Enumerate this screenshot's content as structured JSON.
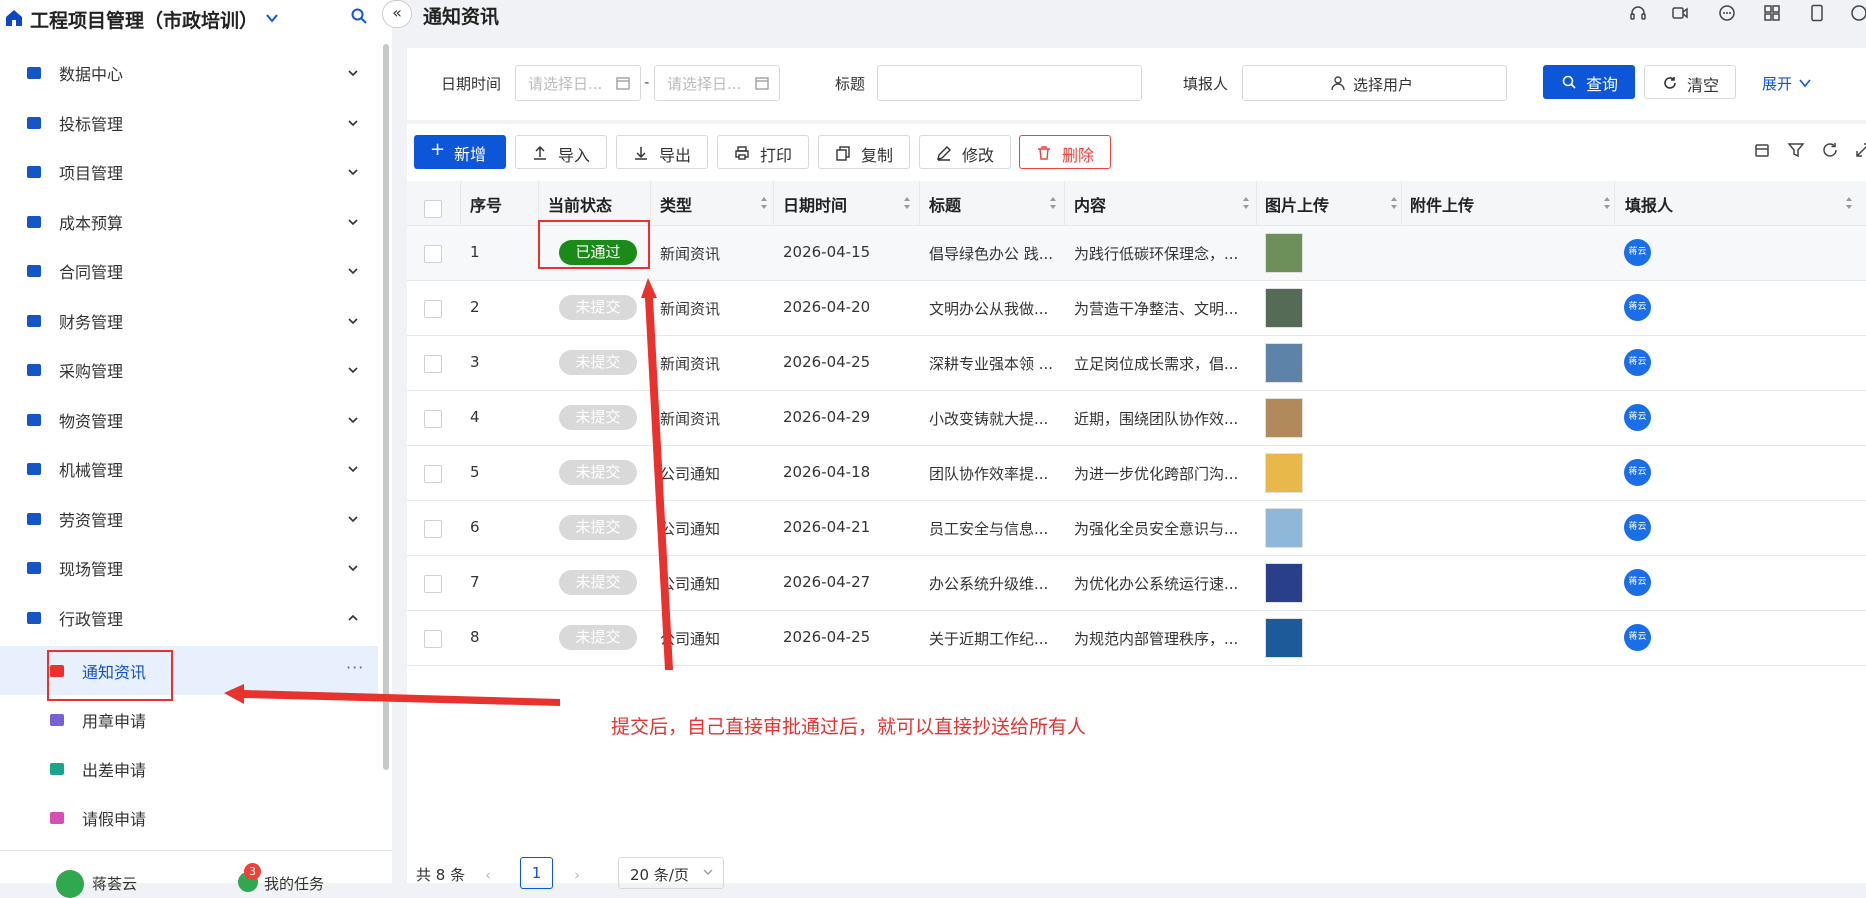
{
  "app": {
    "title": "工程项目管理（市政培训）"
  },
  "sidebar": {
    "menu": [
      {
        "label": "数据中心",
        "icon": "compass-icon"
      },
      {
        "label": "投标管理",
        "icon": "network-icon"
      },
      {
        "label": "项目管理",
        "icon": "project-icon"
      },
      {
        "label": "成本预算",
        "icon": "layers-icon"
      },
      {
        "label": "合同管理",
        "icon": "briefcase-icon"
      },
      {
        "label": "财务管理",
        "icon": "coins-icon"
      },
      {
        "label": "采购管理",
        "icon": "truck-icon"
      },
      {
        "label": "物资管理",
        "icon": "materials-icon"
      },
      {
        "label": "机械管理",
        "icon": "gears-icon"
      },
      {
        "label": "劳资管理",
        "icon": "worker-icon"
      },
      {
        "label": "现场管理",
        "icon": "helmet-icon"
      },
      {
        "label": "行政管理",
        "icon": "archive-icon"
      }
    ],
    "sub_menu": [
      {
        "label": "通知资讯",
        "icon": "megaphone-icon",
        "active": true
      },
      {
        "label": "用章申请",
        "icon": "stamp-icon"
      },
      {
        "label": "出差申请",
        "icon": "travel-icon"
      },
      {
        "label": "请假申请",
        "icon": "edit-icon"
      }
    ],
    "more": "···",
    "footer": {
      "user_name": "蒋荟云",
      "task_label": "我的任务",
      "task_badge": "3"
    }
  },
  "header": {
    "page_title": "通知资讯"
  },
  "filter": {
    "date_label": "日期时间",
    "date_start_placeholder": "请选择日...",
    "date_end_placeholder": "请选择日...",
    "date_dash": "-",
    "title_label": "标题",
    "reporter_label": "填报人",
    "user_select": "选择用户",
    "query_button": "查询",
    "clear_button": "清空",
    "expand_link": "展开"
  },
  "toolbar": {
    "add": "新增",
    "import": "导入",
    "export": "导出",
    "print": "打印",
    "copy": "复制",
    "edit": "修改",
    "delete": "删除"
  },
  "table": {
    "columns": [
      "序号",
      "当前状态",
      "类型",
      "日期时间",
      "标题",
      "内容",
      "图片上传",
      "附件上传",
      "填报人"
    ],
    "rows": [
      {
        "no": "1",
        "status": "已通过",
        "type": "新闻资讯",
        "date": "2026-04-15",
        "title": "倡导绿色办公 践...",
        "content": "为践行低碳环保理念，...",
        "avatar": "蒋云"
      },
      {
        "no": "2",
        "status": "未提交",
        "type": "新闻资讯",
        "date": "2026-04-20",
        "title": "文明办公从我做...",
        "content": "为营造干净整洁、文明...",
        "avatar": "蒋云"
      },
      {
        "no": "3",
        "status": "未提交",
        "type": "新闻资讯",
        "date": "2026-04-25",
        "title": "深耕专业强本领 ...",
        "content": "立足岗位成长需求，倡...",
        "avatar": "蒋云"
      },
      {
        "no": "4",
        "status": "未提交",
        "type": "新闻资讯",
        "date": "2026-04-29",
        "title": "小改变铸就大提...",
        "content": "近期，围绕团队协作效...",
        "avatar": "蒋云"
      },
      {
        "no": "5",
        "status": "未提交",
        "type": "公司通知",
        "date": "2026-04-18",
        "title": "团队协作效率提...",
        "content": "为进一步优化跨部门沟...",
        "avatar": "蒋云"
      },
      {
        "no": "6",
        "status": "未提交",
        "type": "公司通知",
        "date": "2026-04-21",
        "title": "员工安全与信息...",
        "content": "为强化全员安全意识与...",
        "avatar": "蒋云"
      },
      {
        "no": "7",
        "status": "未提交",
        "type": "公司通知",
        "date": "2026-04-27",
        "title": "办公系统升级维...",
        "content": "为优化办公系统运行速...",
        "avatar": "蒋云"
      },
      {
        "no": "8",
        "status": "未提交",
        "type": "公司通知",
        "date": "2026-04-25",
        "title": "关于近期工作纪...",
        "content": "为规范内部管理秩序，...",
        "avatar": "蒋云"
      }
    ]
  },
  "annotation": {
    "text": "提交后，自己直接审批通过后，就可以直接抄送给所有人",
    "color": "#e8322e"
  },
  "pagination": {
    "total": "共 8 条",
    "prev": "‹",
    "page": "1",
    "next": "›",
    "page_size": "20 条/页"
  },
  "colors": {
    "primary": "#0d56d8",
    "success": "#1a8a18",
    "danger": "#f0413b"
  }
}
